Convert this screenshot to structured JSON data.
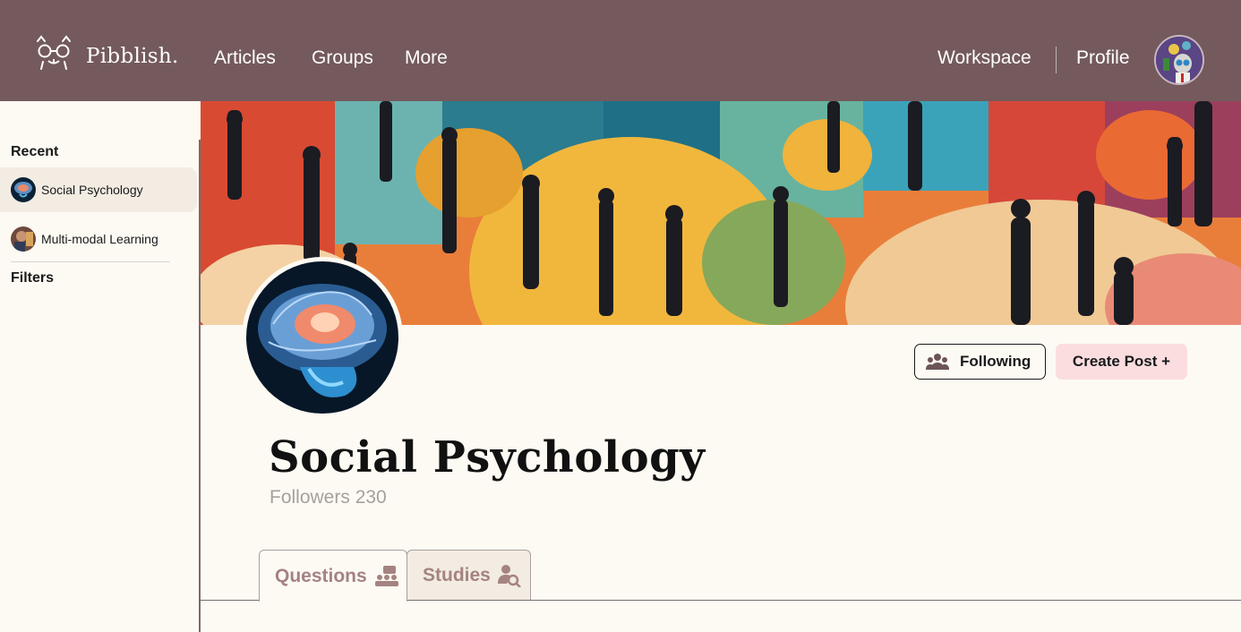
{
  "header": {
    "logo_text": "Pibblish.",
    "nav": {
      "articles": "Articles",
      "groups": "Groups",
      "more": "More",
      "workspace": "Workspace",
      "profile": "Profile"
    },
    "bar_color": "#745a5c"
  },
  "sidebar": {
    "recent_heading": "Recent",
    "items": [
      {
        "label": "Social Psychology",
        "active": true
      },
      {
        "label": "Multi-modal Learning",
        "active": false
      }
    ],
    "filters_heading": "Filters"
  },
  "group": {
    "title": "Social Psychology",
    "followers": "Followers 230",
    "following_label": "Following",
    "create_post_label": "Create Post +"
  },
  "tabs": [
    {
      "label": "Questions",
      "icon": "discussion-group-icon",
      "selected": true
    },
    {
      "label": "Studies",
      "icon": "person-search-icon",
      "selected": false
    }
  ],
  "colors": {
    "create_button": "#fbdde0",
    "tab_text": "#a48381",
    "background": "#fdfaf3"
  }
}
